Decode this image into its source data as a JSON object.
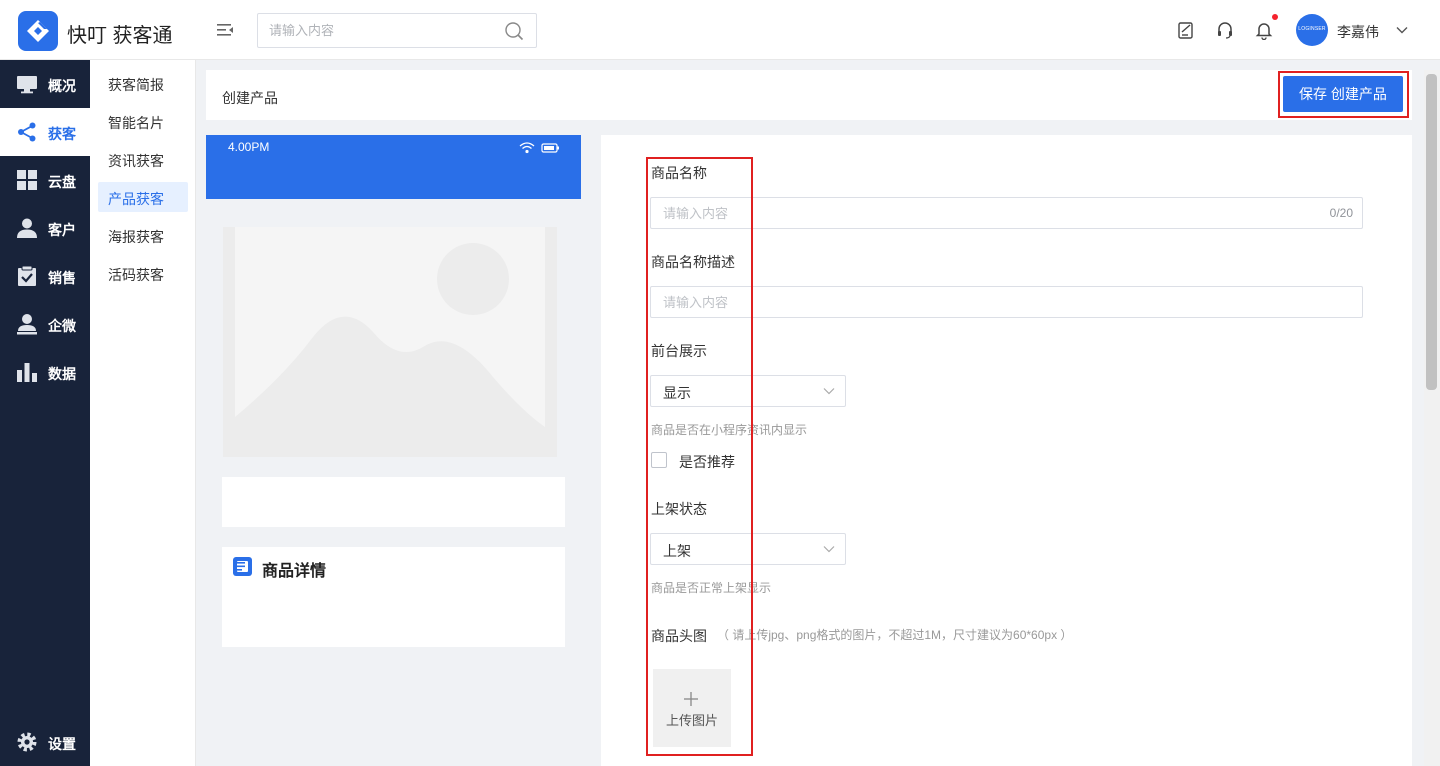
{
  "header": {
    "app_title": "快叮 获客通",
    "search_placeholder": "请输入内容",
    "user_name": "李嘉伟",
    "avatar_text": "LOGINSER"
  },
  "sidebar": {
    "items": [
      {
        "label": "概况",
        "icon": "monitor-icon"
      },
      {
        "label": "获客",
        "icon": "share-icon",
        "active": true
      },
      {
        "label": "云盘",
        "icon": "grid-icon"
      },
      {
        "label": "客户",
        "icon": "person-icon"
      },
      {
        "label": "销售",
        "icon": "clipboard-check-icon"
      },
      {
        "label": "企微",
        "icon": "user-badge-icon"
      },
      {
        "label": "数据",
        "icon": "bar-chart-icon"
      }
    ],
    "settings_label": "设置"
  },
  "subnav": {
    "items": [
      "获客简报",
      "智能名片",
      "资讯获客",
      "产品获客",
      "海报获客",
      "活码获客"
    ],
    "active_index": 3
  },
  "page": {
    "title": "创建产品",
    "save_label": "保存 创建产品"
  },
  "preview": {
    "time": "4.00PM",
    "detail_title": "商品详情"
  },
  "form": {
    "name_label": "商品名称",
    "name_placeholder": "请输入内容",
    "name_counter": "0/20",
    "desc_label": "商品名称描述",
    "desc_placeholder": "请输入内容",
    "display_label": "前台展示",
    "display_value": "显示",
    "display_hint": "商品是否在小程序资讯内显示",
    "recommend_label": "是否推荐",
    "status_label": "上架状态",
    "status_value": "上架",
    "status_hint": "商品是否正常上架显示",
    "image_label": "商品头图",
    "image_hint": "（ 请上传jpg、png格式的图片，不超过1M，尺寸建议为60*60px ）",
    "upload_label": "上传图片"
  },
  "colors": {
    "accent": "#2a6fe8",
    "sidebar_bg": "#18233a",
    "highlight_red": "#e02020"
  }
}
